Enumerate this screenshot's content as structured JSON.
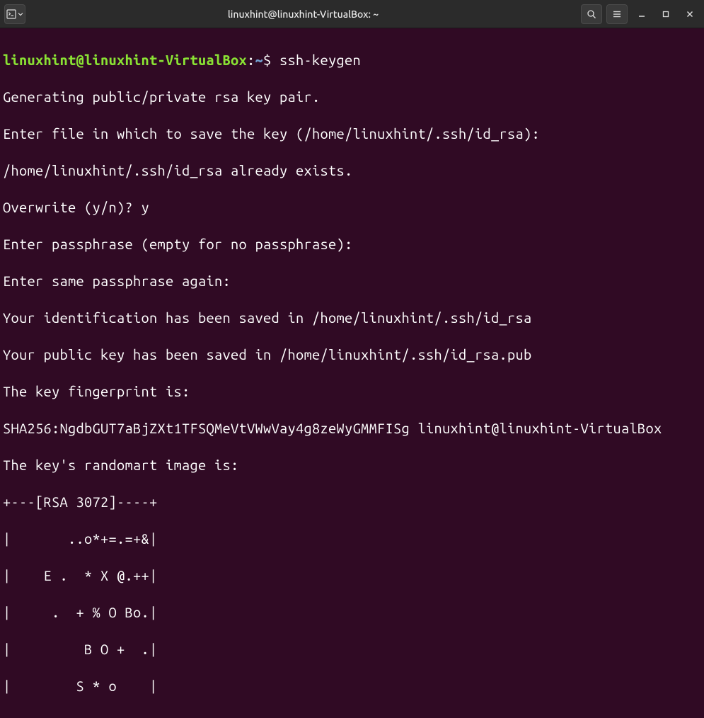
{
  "titlebar": {
    "title": "linuxhint@linuxhint-VirtualBox: ~"
  },
  "terminal": {
    "prompt_user": "linuxhint@linuxhint-VirtualBox",
    "prompt_sep1": ":",
    "prompt_path": "~",
    "prompt_sep2": "$ ",
    "command": "ssh-keygen",
    "lines": {
      "l1": "Generating public/private rsa key pair.",
      "l2": "Enter file in which to save the key (/home/linuxhint/.ssh/id_rsa):",
      "l3": "/home/linuxhint/.ssh/id_rsa already exists.",
      "l4": "Overwrite (y/n)? y",
      "l5": "Enter passphrase (empty for no passphrase):",
      "l6": "Enter same passphrase again:",
      "l7": "Your identification has been saved in /home/linuxhint/.ssh/id_rsa",
      "l8": "Your public key has been saved in /home/linuxhint/.ssh/id_rsa.pub",
      "l9": "The key fingerprint is:",
      "l10": "SHA256:NgdbGUT7aBjZXt1TFSQMeVtVWwVay4g8zeWyGMMFISg linuxhint@linuxhint-VirtualBox",
      "l11": "The key's randomart image is:",
      "l12": "+---[RSA 3072]----+",
      "l13": "|       ..o*+=.=+&|",
      "l14": "|    E .  * X @.++|",
      "l15": "|     .  + % O Bo.|",
      "l16": "|         B O +  .|",
      "l17": "|        S * o    |"
    }
  }
}
